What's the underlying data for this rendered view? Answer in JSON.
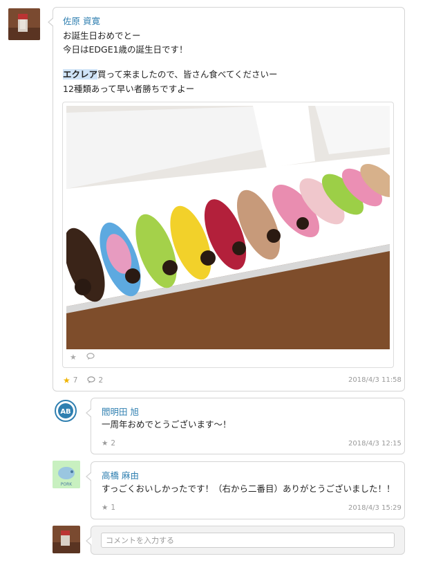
{
  "post": {
    "author": "佐原 資寛",
    "lines": [
      "お誕生日おめでとー",
      "今日はEDGE1歳の誕生日です！",
      "",
      "買って来ましたので、皆さん食べてくださいー",
      "12種類あって早い者勝ちですよー"
    ],
    "highlight": "エクレア",
    "likes": "7",
    "comments": "2",
    "timestamp": "2018/4/3 11:58"
  },
  "comments": [
    {
      "author": "閻明田 旭",
      "text": "一周年おめでとうございます～！",
      "likes": "2",
      "timestamp": "2018/4/3 12:15"
    },
    {
      "author": "高橋 麻由",
      "text": "すっごくおいしかったです！（右から二番目）ありがとうございました！！",
      "likes": "1",
      "timestamp": "2018/4/3 15:29"
    }
  ],
  "compose": {
    "placeholder": "コメントを入力する"
  },
  "colors": {
    "author": "#2f7fb0",
    "star_active": "#f0b400",
    "highlight": "#cfe3f7"
  },
  "icons": {
    "star": "star-icon",
    "comment": "comment-icon"
  }
}
